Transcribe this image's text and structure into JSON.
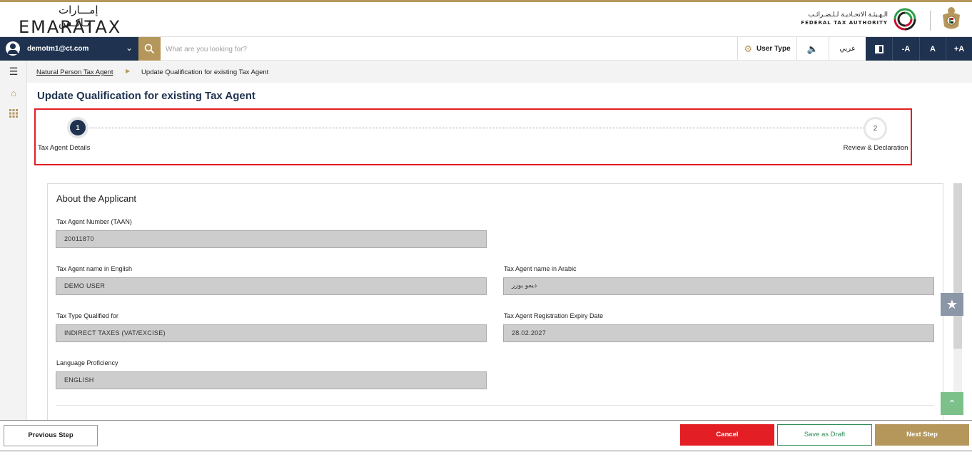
{
  "header": {
    "brand_ar": "إمـــارات تـاكـس",
    "brand_en": "EMARATAX",
    "authority_ar": "الـهـيئـة الاتحـاديـة لـلـضـرائـب",
    "authority_en": "FEDERAL TAX AUTHORITY"
  },
  "toolbar": {
    "user_email": "demotm1@ct.com",
    "search_placeholder": "What are you looking for?",
    "user_type_label": "User Type",
    "language_label": "عربي",
    "font_decrease": "-A",
    "font_normal": "A",
    "font_increase": "+A"
  },
  "breadcrumb": {
    "parent": "Natural Person Tax Agent",
    "current": "Update Qualification for existing Tax Agent"
  },
  "page_title": "Update Qualification for existing Tax Agent",
  "stepper": {
    "steps": [
      {
        "number": "1",
        "label": "Tax Agent Details",
        "state": "active"
      },
      {
        "number": "2",
        "label": "Review & Declaration",
        "state": "pending"
      }
    ]
  },
  "form": {
    "section_title": "About the Applicant",
    "fields": {
      "taan": {
        "label": "Tax Agent Number (TAAN)",
        "value": "20011870"
      },
      "name_en": {
        "label": "Tax Agent name in English",
        "value": "DEMO  USER"
      },
      "name_ar": {
        "label": "Tax Agent name in Arabic",
        "value": "ديمو  يوزر"
      },
      "tax_type": {
        "label": "Tax Type Qualified for",
        "value": "INDIRECT TAXES (VAT/EXCISE)"
      },
      "expiry": {
        "label": "Tax Agent Registration Expiry Date",
        "value": "28.02.2027"
      },
      "language": {
        "label": "Language Proficiency",
        "value": "ENGLISH"
      }
    }
  },
  "footer": {
    "previous": "Previous Step",
    "cancel": "Cancel",
    "save_draft": "Save as Draft",
    "next": "Next Step"
  },
  "colors": {
    "navy": "#1f3250",
    "gold": "#b5975c",
    "cancel_red": "#e31e24",
    "draft_green": "#2e8b57",
    "highlight_border": "#e31e24"
  },
  "icons": [
    "user-icon",
    "chevron-down-icon",
    "search-icon",
    "gear-icon",
    "speaker-icon",
    "contrast-icon",
    "menu-icon",
    "home-icon",
    "grid-icon",
    "star-icon",
    "scroll-top-icon"
  ]
}
